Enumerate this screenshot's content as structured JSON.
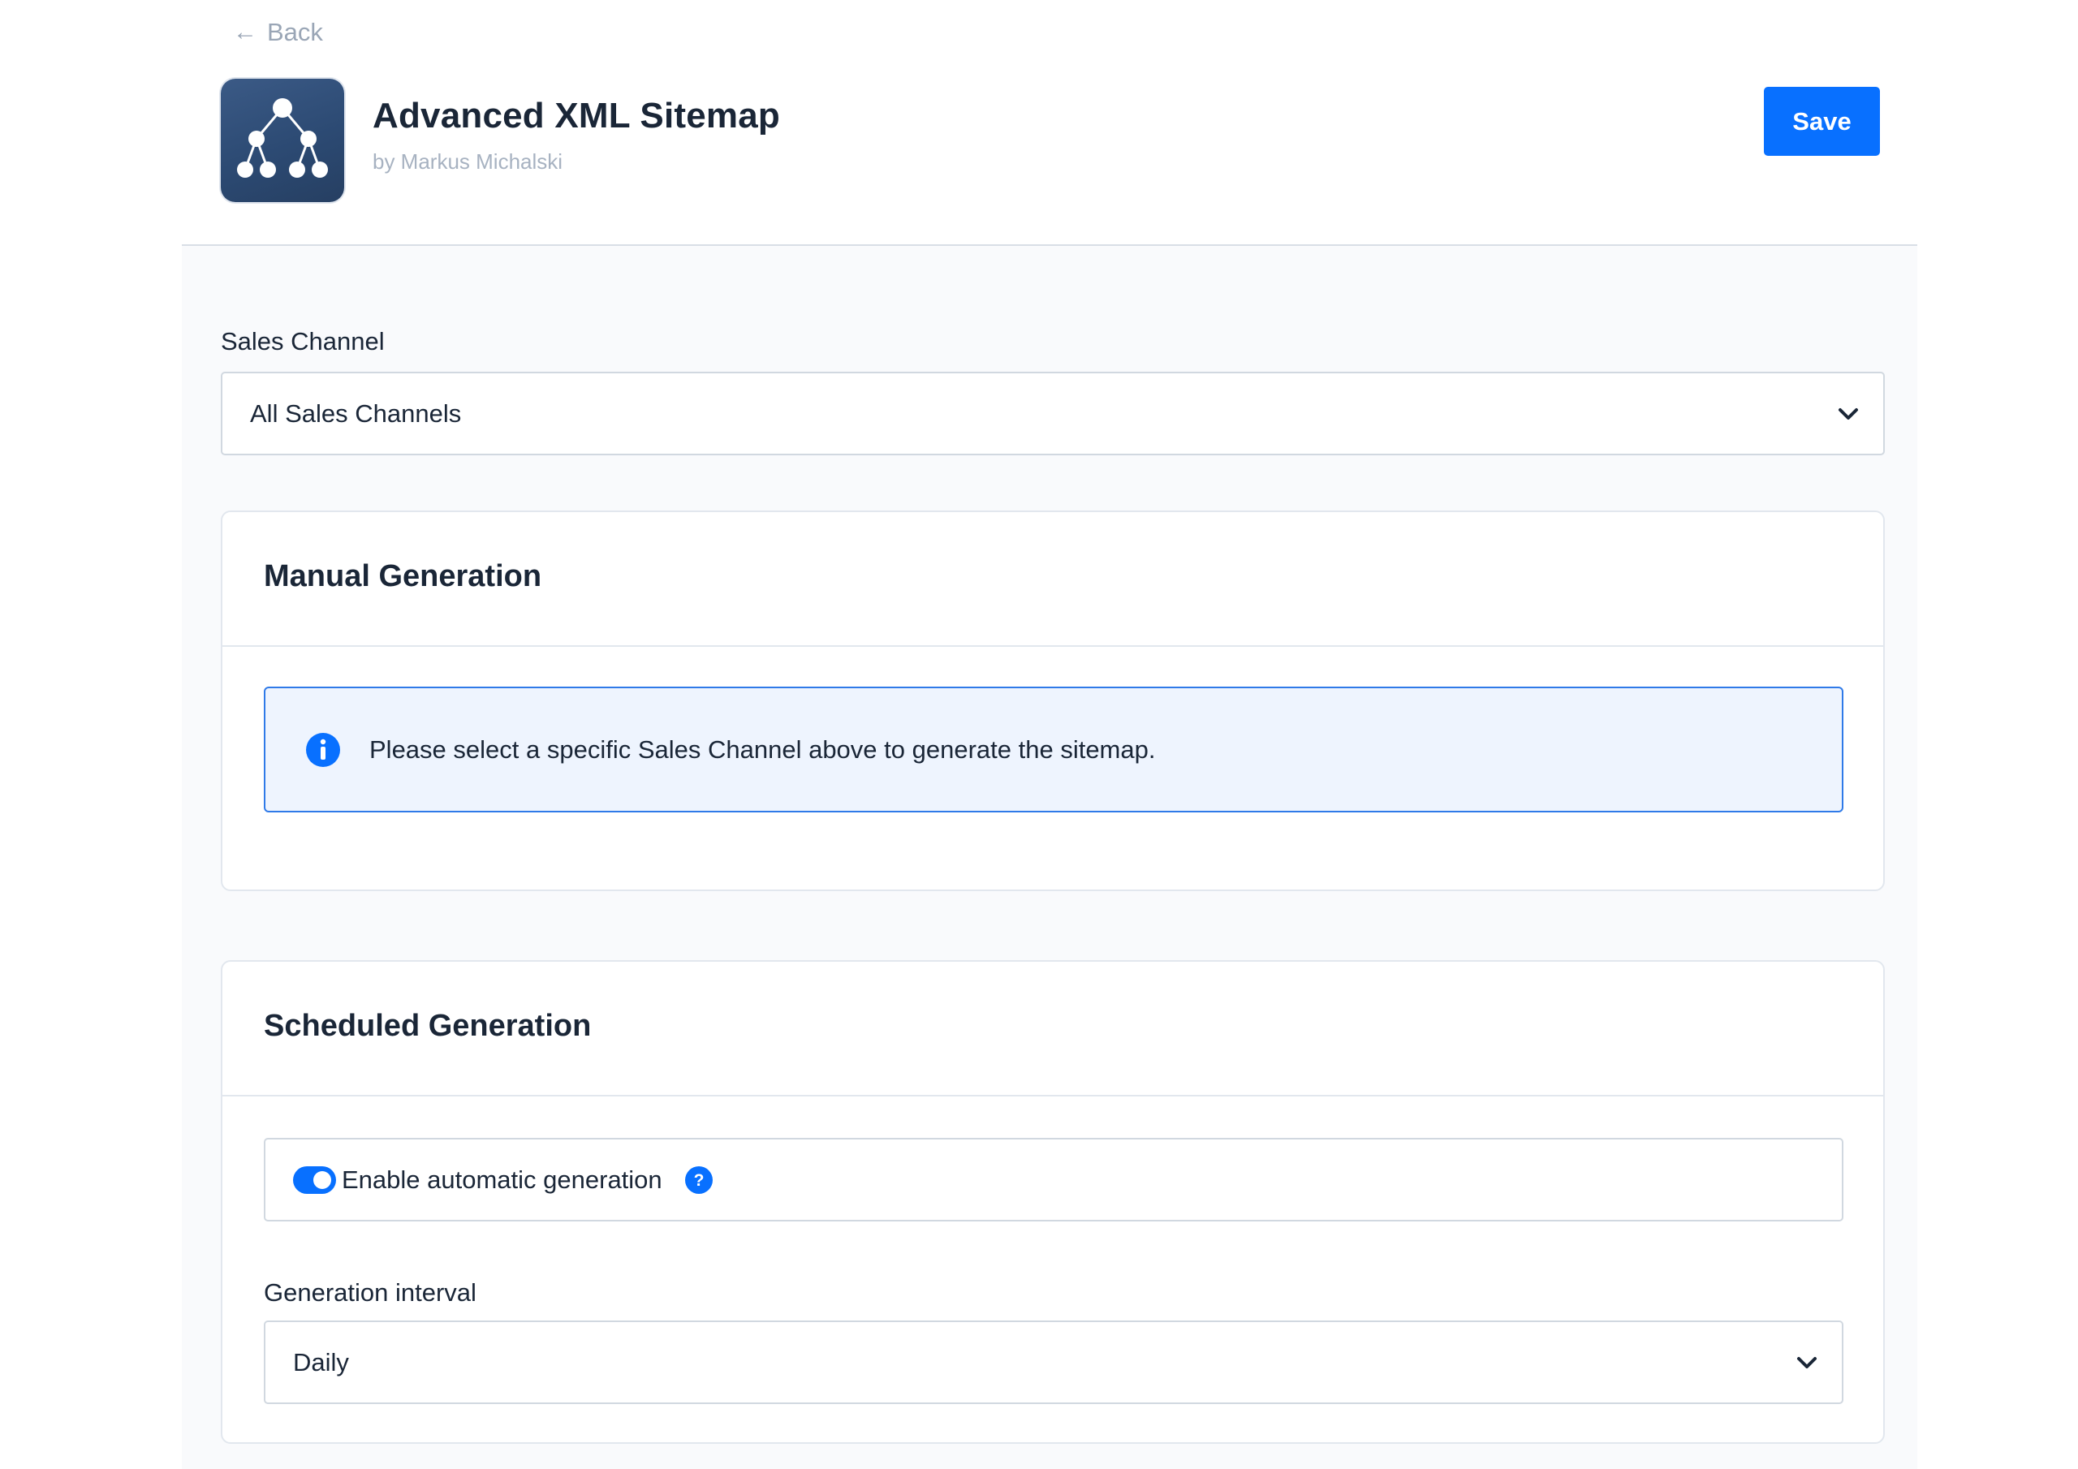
{
  "header": {
    "back_label": "Back",
    "back_icon": "arrow-left-icon",
    "app_icon": "sitemap-tree-icon",
    "app_title": "Advanced XML Sitemap",
    "app_author": "by Markus Michalski",
    "save_label": "Save"
  },
  "sales_channel": {
    "label": "Sales Channel",
    "selected": "All Sales Channels"
  },
  "manual_generation": {
    "title": "Manual Generation",
    "info_message": "Please select a specific Sales Channel above to generate the sitemap."
  },
  "scheduled_generation": {
    "title": "Scheduled Generation",
    "auto_switch_label": "Enable automatic generation",
    "auto_enabled": true,
    "interval_label": "Generation interval",
    "interval_selected": "Daily"
  },
  "colors": {
    "primary": "#0870ff",
    "info_border": "#2f7ae8",
    "info_background": "#eef4fe",
    "app_icon_background": "#2c4a73"
  }
}
